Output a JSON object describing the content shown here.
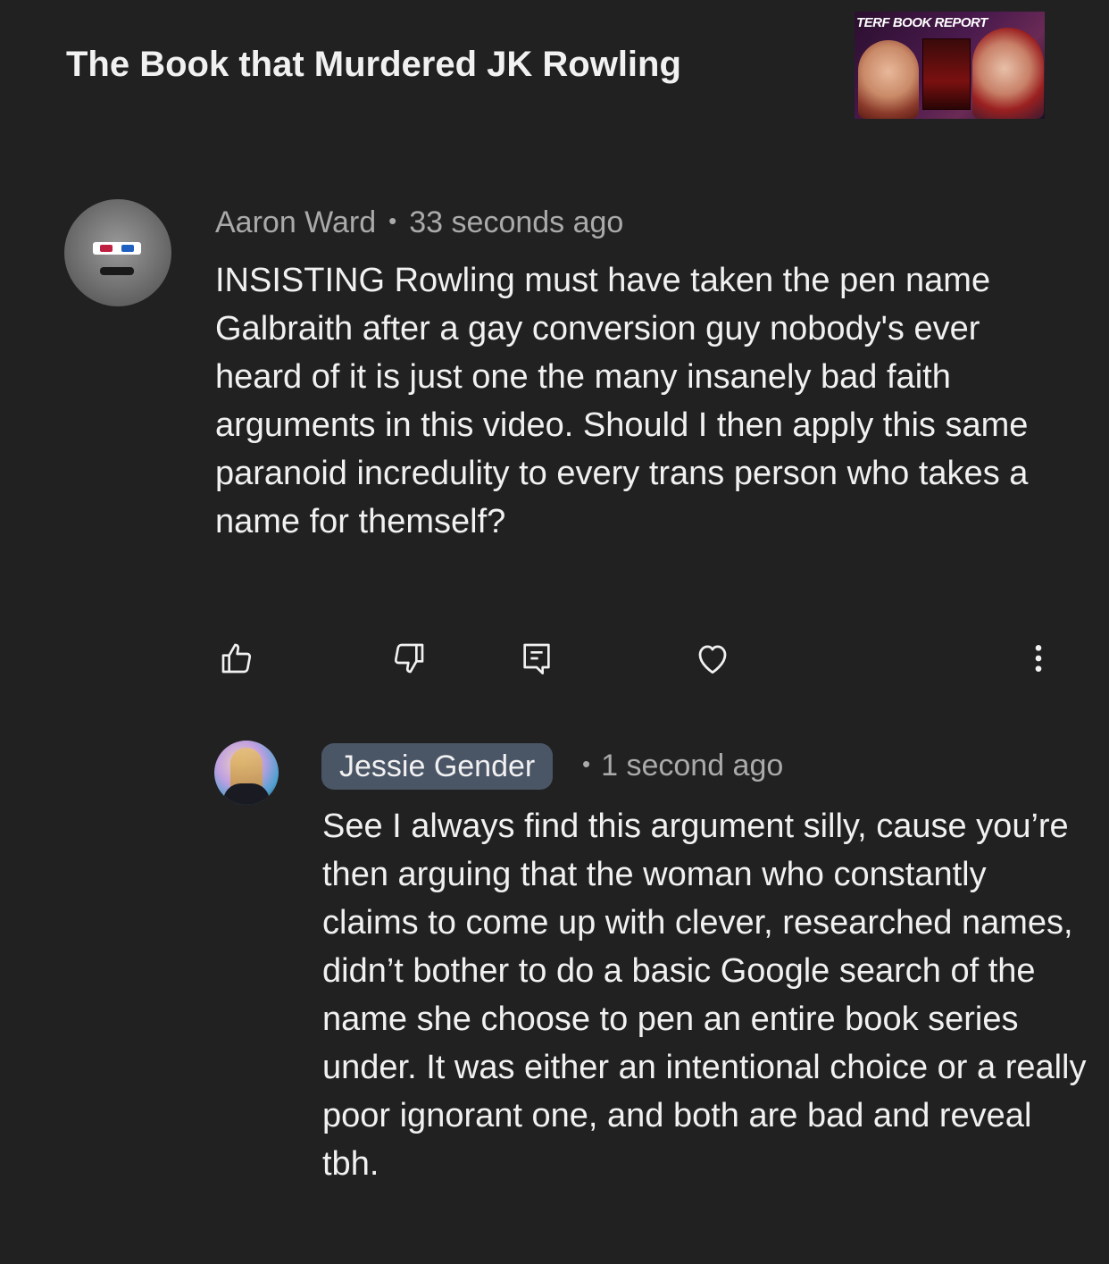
{
  "video": {
    "title": "The Book that Murdered JK Rowling",
    "thumbnail_title": "TERF BOOK REPORT"
  },
  "comment": {
    "author": "Aaron Ward",
    "separator": "•",
    "time": "33 seconds ago",
    "text": "INSISTING Rowling must have taken the pen name Galbraith after a gay conversion guy nobody's ever heard of it is just one the many insanely bad faith arguments in this video. Should I then apply this same paranoid incredulity to every trans person who takes a name for themself?",
    "actions": {
      "like_icon": "thumbs-up-icon",
      "dislike_icon": "thumbs-down-icon",
      "reply_icon": "reply-icon",
      "heart_icon": "heart-icon",
      "more_icon": "more-vertical-icon"
    }
  },
  "reply": {
    "author": "Jessie Gender",
    "separator": "•",
    "time": "1 second ago",
    "text": "See I always find this argument silly, cause you’re then arguing that the woman who constantly claims to come up with clever, researched names, didn’t bother to do a basic Google search of the name she choose to pen an entire book series under. It was either an intentional choice or a really poor ignorant one, and both are bad and reveal tbh."
  },
  "colors": {
    "background": "#212121",
    "text_primary": "#f1f1f1",
    "text_secondary": "#aaaaaa",
    "author_chip": "#4a5566"
  }
}
